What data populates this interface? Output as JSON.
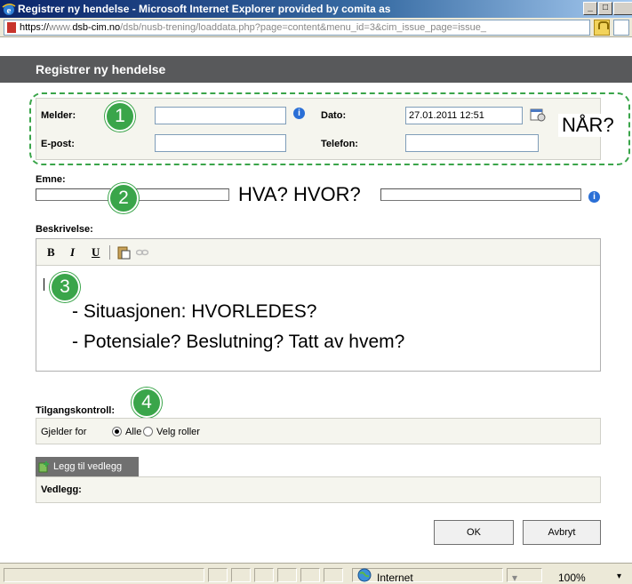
{
  "window": {
    "title": "Registrer ny hendelse - Microsoft Internet Explorer provided by comita as",
    "minimize": "_",
    "maximize": "□"
  },
  "address": {
    "protocol": "https://",
    "host_prefix": "www.",
    "host": "dsb-cim.no",
    "path": "/dsb/nusb-trening/loaddata.php?page=content&menu_id=3&cim_issue_page=issue_"
  },
  "dialog": {
    "title": "Registrer ny hendelse"
  },
  "section1": {
    "melder_label": "Melder:",
    "melder_value": "",
    "dato_label": "Dato:",
    "dato_value": "27.01.2011 12:51",
    "epost_label": "E-post:",
    "epost_value": "",
    "telefon_label": "Telefon:",
    "telefon_value": "",
    "badge": "1",
    "callout": "NÅR?",
    "info_icon": "i"
  },
  "section2": {
    "emne_label": "Emne:",
    "badge": "2",
    "callout": "HVA? HVOR?"
  },
  "section3": {
    "label": "Beskrivelse:",
    "toolbar": {
      "bold": "B",
      "italic": "I",
      "underline": "U"
    },
    "badge": "3",
    "line1": "- Situasjonen: HVORLEDES?",
    "line2": "- Potensiale? Beslutning? Tatt av hvem?"
  },
  "section4": {
    "label": "Tilgangskontroll:",
    "badge": "4",
    "gjelder_for": "Gjelder for",
    "option_all": "Alle",
    "option_roles": "Velg roller",
    "selected": "Alle"
  },
  "attachment": {
    "tab_label": "Legg til vedlegg",
    "label": "Vedlegg:"
  },
  "buttons": {
    "ok": "OK",
    "cancel": "Avbryt"
  },
  "statusbar": {
    "zone": "Internet",
    "zoom": "100%"
  },
  "colors": {
    "annotation_green": "#3aa54a",
    "dialog_header": "#58595b",
    "info_blue": "#2a6fd6"
  }
}
